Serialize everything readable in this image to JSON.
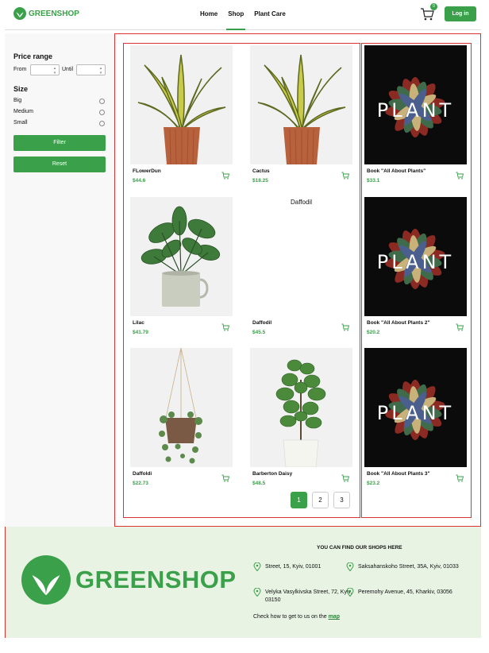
{
  "header": {
    "brand": "GREENSHOP",
    "nav": [
      "Home",
      "Shop",
      "Plant Care"
    ],
    "active_nav": "Shop",
    "cart_count": "0",
    "login_label": "Log in"
  },
  "sidebar": {
    "price_title": "Price range",
    "from_label": "From",
    "until_label": "Until",
    "size_title": "Size",
    "sizes": [
      "Big",
      "Medium",
      "Small"
    ],
    "filter_label": "Filter",
    "reset_label": "Reset"
  },
  "products": [
    {
      "name": "FLowerDun",
      "price": "$44.6",
      "image": "snake-plant"
    },
    {
      "name": "Cactus",
      "price": "$18.25",
      "image": "snake-plant"
    },
    {
      "name": "Lilac",
      "price": "$41.79",
      "image": "potted-plant"
    },
    {
      "name": "Daffodil",
      "price": "$45.5",
      "image": "broken",
      "alt": "Daffodil"
    },
    {
      "name": "Daffoldi",
      "price": "$22.73",
      "image": "hanging-plant"
    },
    {
      "name": "Barberton Daisy",
      "price": "$48.5",
      "image": "fiddle-leaf"
    }
  ],
  "books": [
    {
      "name": "Book \"All About Plants\"",
      "price": "$33.1",
      "cover_word": "PLANT"
    },
    {
      "name": "Book \"All About Plants 2\"",
      "price": "$20.2",
      "cover_word": "PLANT"
    },
    {
      "name": "Book \"All About Plants 3\"",
      "price": "$23.2",
      "cover_word": "PLANT"
    }
  ],
  "pagination": [
    "1",
    "2",
    "3"
  ],
  "current_page": "1",
  "footer": {
    "brand": "GREENSHOP",
    "title": "YOU CAN FIND OUR SHOPS HERE",
    "addresses": [
      "Street, 15, Kyiv, 01001",
      "Saksahanskoho Street, 35A, Kyiv, 01033",
      "Velyka Vasylkivska Street, 72, Kyiv, 03150",
      "Peremohy Avenue, 45, Kharkiv, 03056"
    ],
    "map_text": "Check how to get to us on the",
    "map_link": "map"
  },
  "colors": {
    "accent": "#3aa04a",
    "debug_border": "#d33",
    "footer_bg": "#e8f3e3"
  }
}
